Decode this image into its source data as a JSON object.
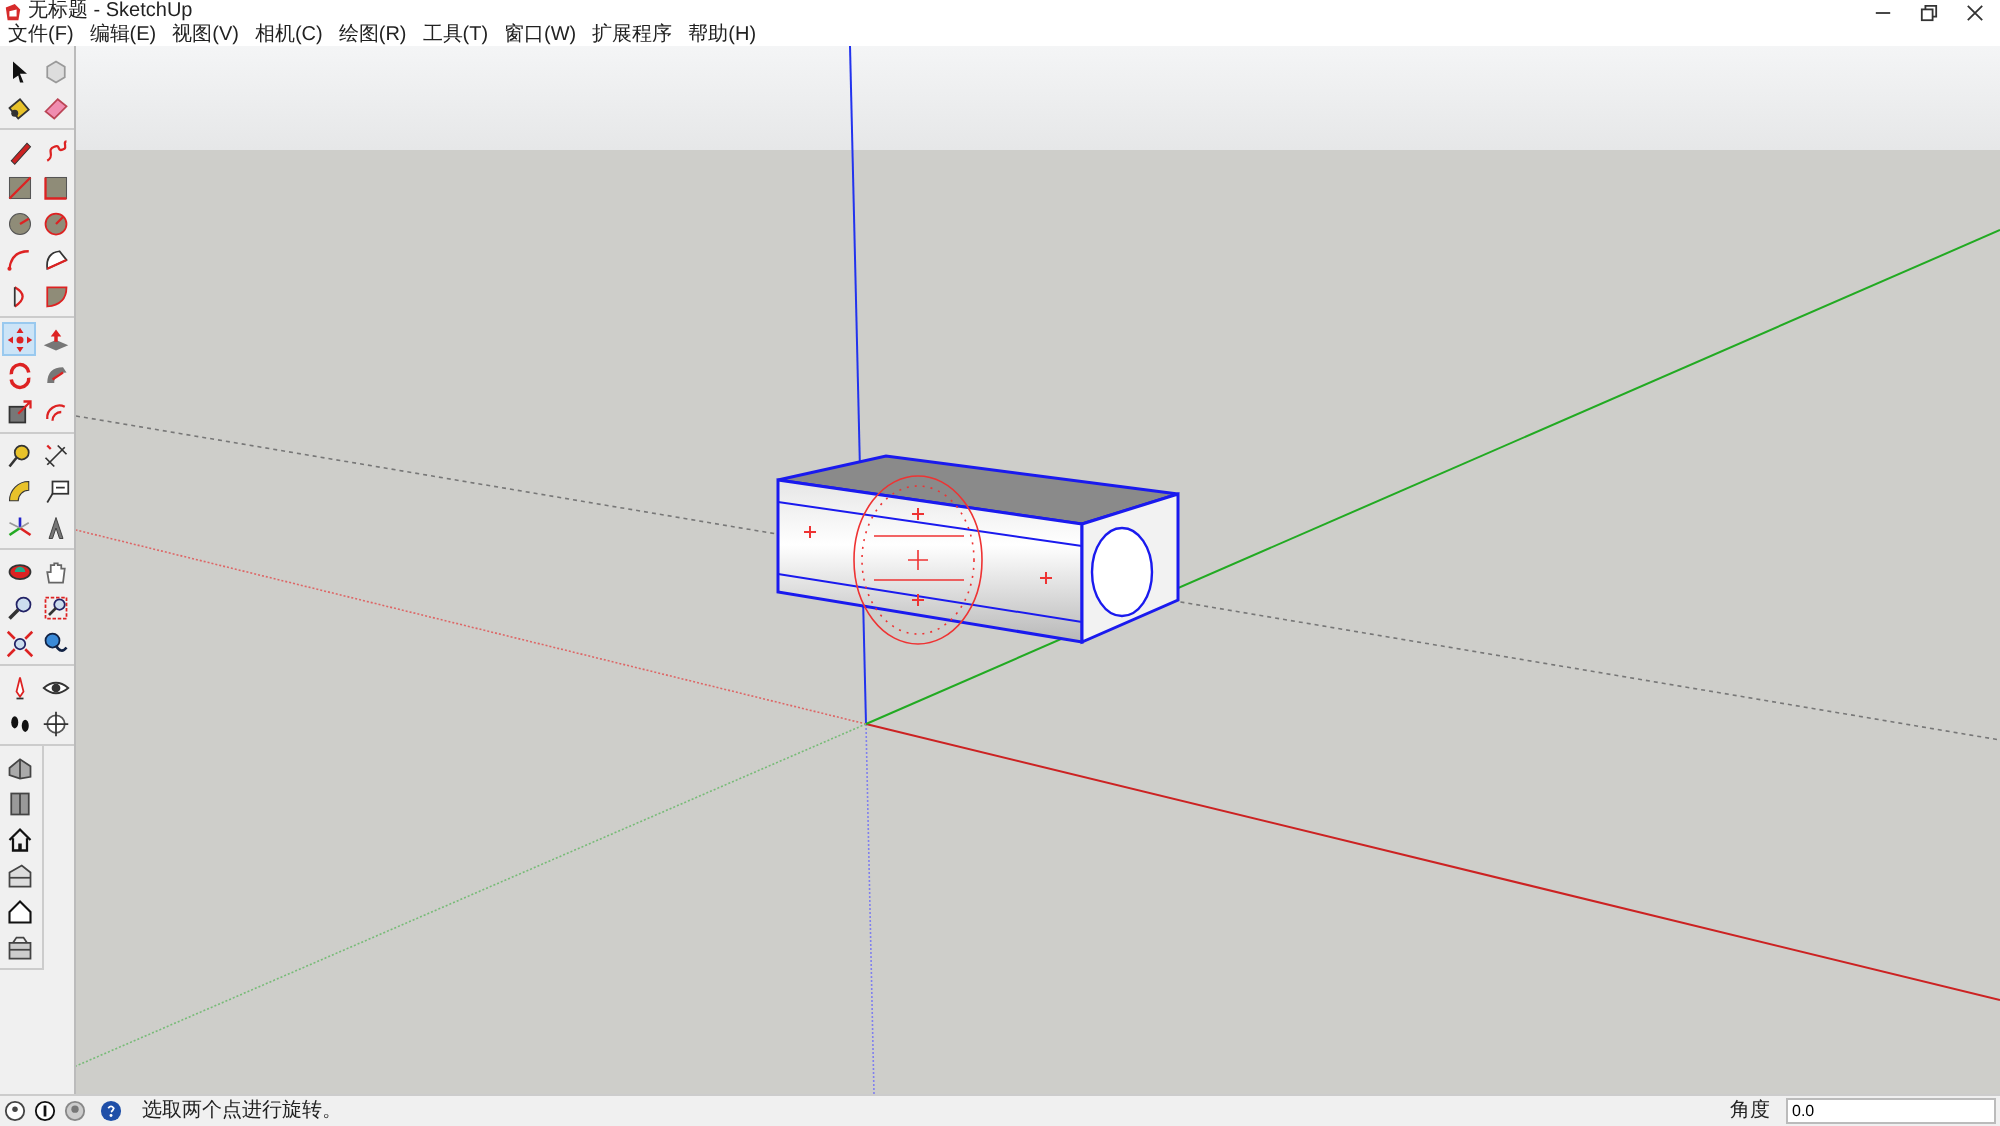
{
  "window": {
    "title": "无标题 - SketchUp"
  },
  "menu": [
    "文件(F)",
    "编辑(E)",
    "视图(V)",
    "相机(C)",
    "绘图(R)",
    "工具(T)",
    "窗口(W)",
    "扩展程序",
    "帮助(H)"
  ],
  "toolbars": [
    {
      "kind": "double",
      "tools": [
        {
          "selected": false
        },
        {
          "selected": false
        },
        {
          "selected": false
        },
        {
          "selected": false
        }
      ]
    },
    {
      "kind": "double",
      "tools": [
        {
          "selected": false
        },
        {
          "selected": false
        },
        {
          "selected": false
        },
        {
          "selected": false
        },
        {
          "selected": false
        },
        {
          "selected": false
        },
        {
          "selected": false
        },
        {
          "selected": false
        },
        {
          "selected": false
        },
        {
          "selected": false
        }
      ]
    },
    {
      "kind": "double",
      "tools": [
        {
          "selected": true
        },
        {
          "selected": false
        },
        {
          "selected": false
        },
        {
          "selected": false
        },
        {
          "selected": false
        },
        {
          "selected": false
        }
      ]
    },
    {
      "kind": "double",
      "tools": [
        {
          "selected": false
        },
        {
          "selected": false
        },
        {
          "selected": false
        },
        {
          "selected": false
        },
        {
          "selected": false
        },
        {
          "selected": false
        }
      ]
    },
    {
      "kind": "double",
      "tools": [
        {
          "selected": false
        },
        {
          "selected": false
        },
        {
          "selected": false
        },
        {
          "selected": false
        },
        {
          "selected": false
        },
        {
          "selected": false
        }
      ]
    },
    {
      "kind": "double",
      "tools": [
        {
          "selected": false
        },
        {
          "selected": false
        },
        {
          "selected": false
        },
        {
          "selected": false
        }
      ]
    },
    {
      "kind": "single",
      "tools": [
        {
          "selected": false
        },
        {
          "selected": false
        },
        {
          "selected": false
        },
        {
          "selected": false
        },
        {
          "selected": false
        },
        {
          "selected": false
        }
      ]
    }
  ],
  "status_bar": {
    "message": "选取两个点进行旋转。",
    "measurement": {
      "label": "角度",
      "value": "0.0"
    }
  }
}
